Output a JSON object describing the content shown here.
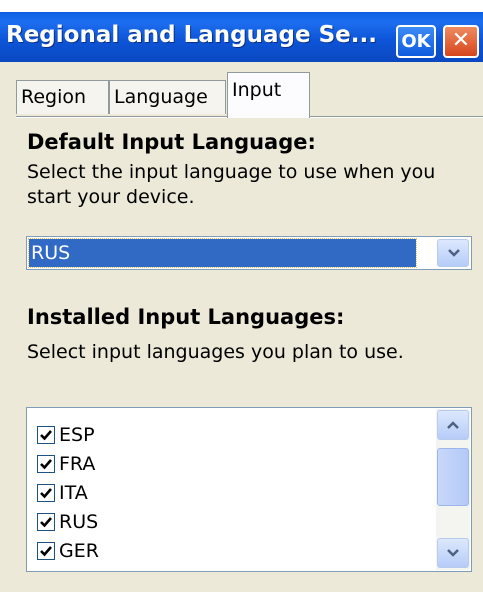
{
  "window": {
    "title": "Regional and Language Se...",
    "ok_label": "OK",
    "close_label": "✕"
  },
  "tabs": [
    {
      "label": "Region"
    },
    {
      "label": "Language"
    },
    {
      "label": "Input",
      "active": true
    }
  ],
  "default_input": {
    "heading": "Default Input Language:",
    "description": "Select the input language to use when you start your device.",
    "selected_value": "RUS"
  },
  "installed": {
    "heading": "Installed Input Languages:",
    "description": "Select input languages you plan to use.",
    "items": [
      {
        "label": "ESP",
        "checked": true
      },
      {
        "label": "FRA",
        "checked": true
      },
      {
        "label": "ITA",
        "checked": true
      },
      {
        "label": "RUS",
        "checked": true
      },
      {
        "label": "GER",
        "checked": true
      }
    ]
  },
  "icons": {
    "dropdown": "chevron-down-icon",
    "scroll_up": "chevron-up-icon",
    "scroll_down": "chevron-down-icon",
    "check": "checkmark-icon"
  },
  "colors": {
    "titlebar": "#0a5fe0",
    "selection": "#316ac5",
    "close": "#d7461c",
    "dialog_bg": "#ece9d8"
  }
}
